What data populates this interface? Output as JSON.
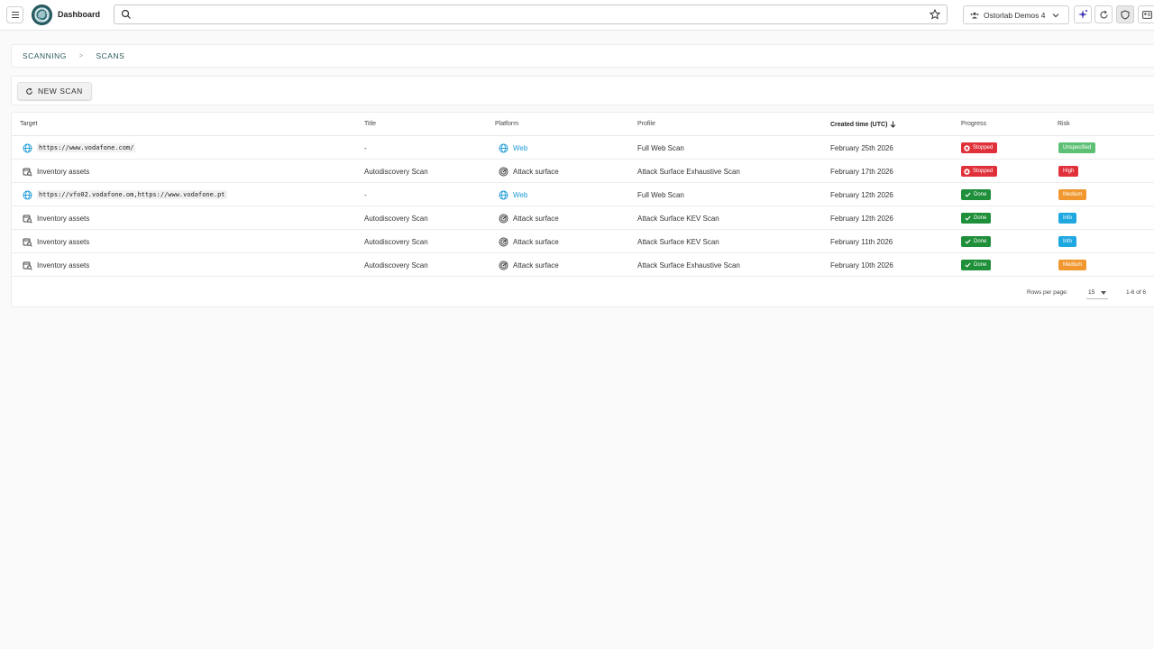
{
  "app": {
    "title": "Dashboard"
  },
  "search": {
    "placeholder": "",
    "value": ""
  },
  "org": {
    "name": "Ostorlab Demos 4"
  },
  "breadcrumb": {
    "items": [
      "SCANNING",
      "SCANS"
    ],
    "separator": ">"
  },
  "actions": {
    "new_scan_label": "NEW SCAN"
  },
  "table": {
    "headers": {
      "target": "Target",
      "title": "Title",
      "platform": "Platform",
      "profile": "Profile",
      "created": "Created time (UTC)",
      "progress": "Progress",
      "risk": "Risk"
    },
    "rows": [
      {
        "target": "https://www.vodafone.com/",
        "target_kind": "url",
        "title": "-",
        "platform": "Web",
        "profile": "Full Web Scan",
        "created": "February 25th 2026",
        "progress": "Stopped",
        "risk": "Unspecified"
      },
      {
        "target": "Inventory assets",
        "target_kind": "inventory",
        "title": "Autodiscovery Scan",
        "platform": "Attack surface",
        "profile": "Attack Surface Exhaustive Scan",
        "created": "February 17th 2026",
        "progress": "Stopped",
        "risk": "High"
      },
      {
        "target": "https://vfo02.vodafone.om,https://www.vodafone.pt",
        "target_kind": "url",
        "title": "-",
        "platform": "Web",
        "profile": "Full Web Scan",
        "created": "February 12th 2026",
        "progress": "Done",
        "risk": "Medium"
      },
      {
        "target": "Inventory assets",
        "target_kind": "inventory",
        "title": "Autodiscovery Scan",
        "platform": "Attack surface",
        "profile": "Attack Surface KEV Scan",
        "created": "February 12th 2026",
        "progress": "Done",
        "risk": "Info"
      },
      {
        "target": "Inventory assets",
        "target_kind": "inventory",
        "title": "Autodiscovery Scan",
        "platform": "Attack surface",
        "profile": "Attack Surface KEV Scan",
        "created": "February 11th 2026",
        "progress": "Done",
        "risk": "Info"
      },
      {
        "target": "Inventory assets",
        "target_kind": "inventory",
        "title": "Autodiscovery Scan",
        "platform": "Attack surface",
        "profile": "Attack Surface Exhaustive Scan",
        "created": "February 10th 2026",
        "progress": "Done",
        "risk": "Medium"
      }
    ]
  },
  "pagination": {
    "rows_per_page_label": "Rows per page:",
    "rows_per_page": "15",
    "range": "1-6 of 6"
  },
  "colors": {
    "stopped": "#e0313b",
    "done": "#1f8f3a",
    "unspecified": "#5ec075",
    "high": "#e0313b",
    "medium": "#f0982f",
    "info": "#1fa7e0",
    "web": "#1e9ad6"
  },
  "icons": {
    "menu": "hamburger-icon",
    "search": "search-icon",
    "star": "star-icon",
    "org": "users-icon",
    "ai": "sparkle-icon",
    "refresh": "refresh-icon",
    "shield": "shield-icon",
    "id": "id-card-icon"
  }
}
